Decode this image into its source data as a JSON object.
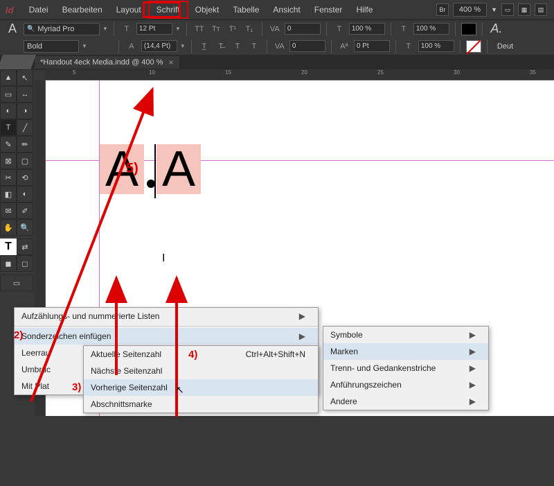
{
  "app": {
    "logo": "Id"
  },
  "menubar": {
    "items": [
      "Datei",
      "Bearbeiten",
      "Layout",
      "Schrift",
      "Objekt",
      "Tabelle",
      "Ansicht",
      "Fenster",
      "Hilfe"
    ],
    "highlighted_index": 3,
    "right": {
      "br": "Br",
      "zoom": "400 %"
    }
  },
  "control": {
    "font": "Myriad Pro",
    "weight": "Bold",
    "size": "12 Pt",
    "leading": "(14,4 Pt)",
    "tracking1": "0",
    "tracking2": "0",
    "scale1": "100 %",
    "scale2": "100 %",
    "scale3": "100 %",
    "baseline": "0 Pt",
    "lang": "Deut"
  },
  "tab": {
    "title": "*Handout 4eck Media.indd @ 400 %",
    "close": "×"
  },
  "ruler": {
    "ticks": [
      "5",
      "10",
      "15",
      "20",
      "25",
      "30",
      "35"
    ]
  },
  "canvas": {
    "charA": "A",
    "note5": "5)"
  },
  "menus": {
    "m1": {
      "items": [
        {
          "label": "Aufzählungs- und nummerierte Listen",
          "arrow": true
        },
        {
          "label": "Sonderzeichen einfügen",
          "arrow": true,
          "hover": true
        },
        {
          "label": "Leerrau"
        },
        {
          "label": "Umbruc"
        },
        {
          "label": "Mit Plat"
        }
      ]
    },
    "m2": {
      "items": [
        {
          "label": "Aktuelle Seitenzahl",
          "shortcut": "Ctrl+Alt+Shift+N"
        },
        {
          "label": "Nächste Seitenzahl"
        },
        {
          "label": "Vorherige Seitenzahl",
          "hover": true
        },
        {
          "label": "Abschnittsmarke"
        }
      ]
    },
    "m3": {
      "items": [
        {
          "label": "Symbole",
          "arrow": true
        },
        {
          "label": "Marken",
          "arrow": true,
          "hover": true
        },
        {
          "label": "Trenn- und Gedankenstriche",
          "arrow": true
        },
        {
          "label": "Anführungszeichen",
          "arrow": true
        },
        {
          "label": "Andere",
          "arrow": true
        }
      ]
    }
  },
  "annotations": {
    "n2": "2)",
    "n3": "3)",
    "n4": "4)",
    "n5": "5)"
  }
}
